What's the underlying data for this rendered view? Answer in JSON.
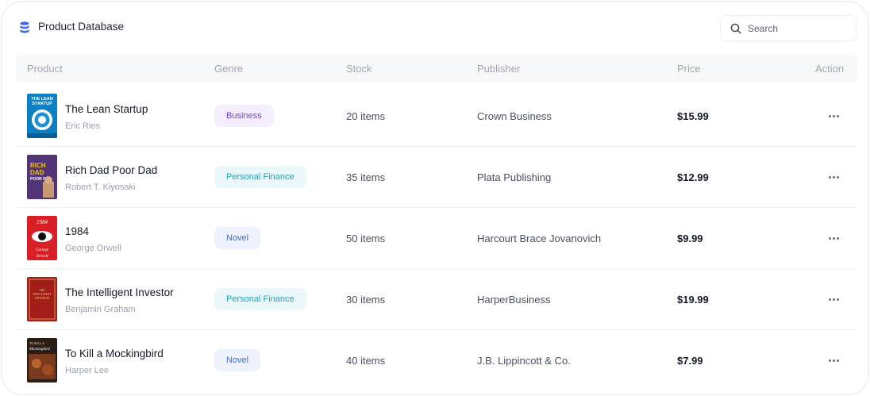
{
  "header": {
    "title": "Product Database"
  },
  "search": {
    "placeholder": "Search",
    "value": ""
  },
  "columns": [
    "Product",
    "Genre",
    "Stock",
    "Publisher",
    "Price",
    "Action"
  ],
  "rows": [
    {
      "name": "The Lean Startup",
      "author": "Eric Ries",
      "genre": "Business",
      "stock": "20 items",
      "publisher": "Crown Business",
      "price": "$15.99"
    },
    {
      "name": "Rich Dad Poor Dad",
      "author": "Robert T. Kiyosaki",
      "genre": "Personal Finance",
      "stock": "35 items",
      "publisher": "Plata Publishing",
      "price": "$12.99"
    },
    {
      "name": "1984",
      "author": "George Orwell",
      "genre": "Novel",
      "stock": "50 items",
      "publisher": "Harcourt Brace Jovanovich",
      "price": "$9.99"
    },
    {
      "name": "The Intelligent Investor",
      "author": "Benjamin Graham",
      "genre": "Personal Finance",
      "stock": "30 items",
      "publisher": "HarperBusiness",
      "price": "$19.99"
    },
    {
      "name": "To Kill a Mockingbird",
      "author": "Harper Lee",
      "genre": "Novel",
      "stock": "40 items",
      "publisher": "J.B. Lippincott & Co.",
      "price": "$7.99"
    }
  ],
  "covers": {
    "lean": "THE LEAN STARTUP",
    "rich": [
      "RICH",
      "DAD",
      "POOR DAD"
    ],
    "orwell": [
      "1984",
      "George",
      "Orwell"
    ],
    "investor": [
      "THE",
      "INTELLIGENT",
      "INVESTOR"
    ],
    "mocking": "To Kill a Mockingbird"
  },
  "colors": {
    "accent": "#3f6ae0",
    "business_badge": "#7a3fe0",
    "finance_badge": "#1ea2ba",
    "novel_badge": "#3f6ae0"
  },
  "icons": {
    "header": "database-icon",
    "search": "search-icon",
    "action": "more-horizontal-icon"
  }
}
